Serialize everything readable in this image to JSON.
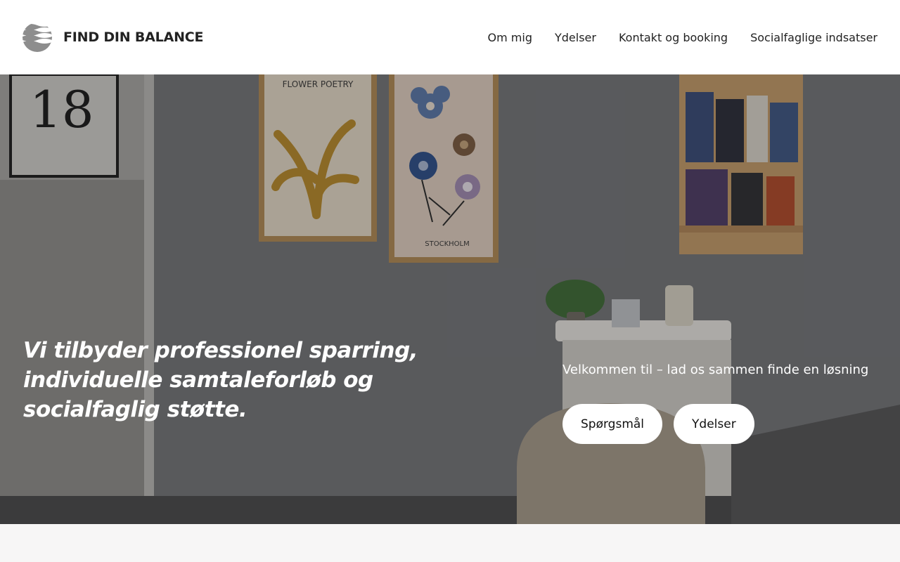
{
  "brand": {
    "name": "FIND DIN BALANCE",
    "logo_icon": "wave-sphere-icon"
  },
  "nav": {
    "items": [
      {
        "label": "Om mig"
      },
      {
        "label": "Ydelser"
      },
      {
        "label": "Kontakt og booking"
      },
      {
        "label": "Socialfaglige indsatser"
      }
    ]
  },
  "hero": {
    "headline": "Vi tilbyder professionel sparring, individuelle samtaleforløb og socialfaglig støtte.",
    "welcome": "Velkommen til – lad os sammen finde en løsning",
    "buttons": [
      {
        "label": "Spørgsmål"
      },
      {
        "label": "Ydelser"
      }
    ],
    "photo": {
      "room_number": "18",
      "poster_left_title": "FLOWER POETRY",
      "poster_right_caption": "STOCKHOLM"
    }
  },
  "colors": {
    "header_bg": "#ffffff",
    "text_dark": "#222222",
    "hero_text": "#ffffff",
    "button_bg": "#ffffff",
    "page_bg": "#f7f6f6"
  }
}
